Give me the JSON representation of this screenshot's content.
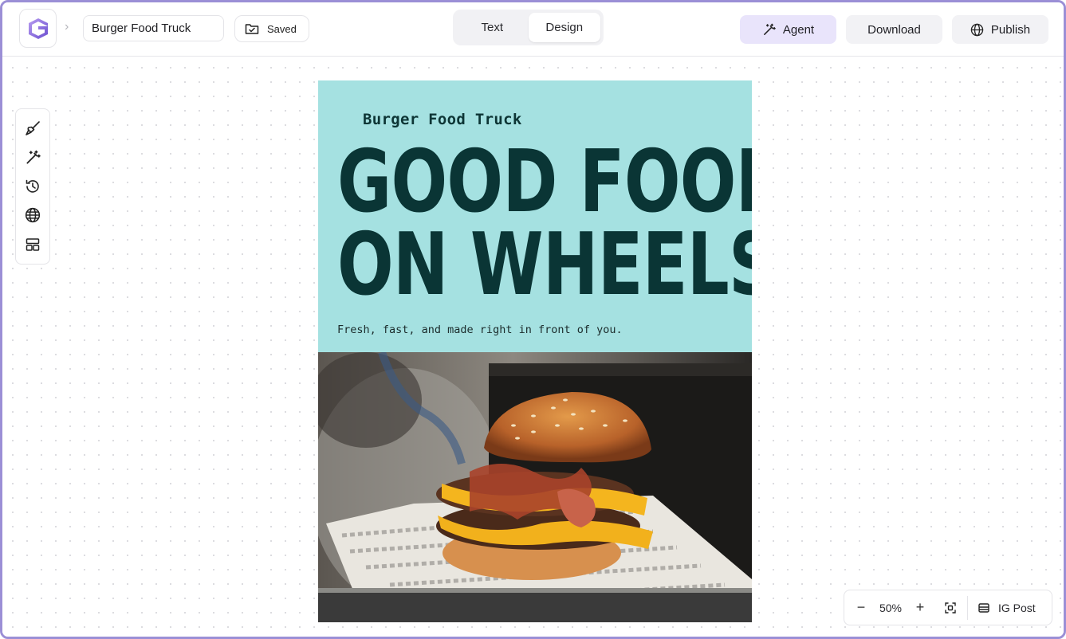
{
  "header": {
    "document_title": "Burger Food Truck",
    "saved_label": "Saved",
    "tabs": [
      {
        "label": "Text",
        "active": false
      },
      {
        "label": "Design",
        "active": true
      }
    ],
    "agent_label": "Agent",
    "download_label": "Download",
    "publish_label": "Publish"
  },
  "toolbar": {
    "items": [
      "brush-icon",
      "magic-wand-icon",
      "history-icon",
      "globe-icon",
      "layout-icon"
    ]
  },
  "poster": {
    "brand": "Burger Food Truck",
    "headline_line1": "GOOD FOOD",
    "headline_line2": "ON WHEELS",
    "tagline": "Fresh, fast, and made right in front of you.",
    "background_color": "#a5e1e1",
    "text_color": "#0a3535",
    "photo_description": "burger-photo"
  },
  "zoom": {
    "level": "50%",
    "format_label": "IG Post"
  },
  "colors": {
    "accent": "#e9e4fb",
    "frame": "#9b8fd6"
  }
}
